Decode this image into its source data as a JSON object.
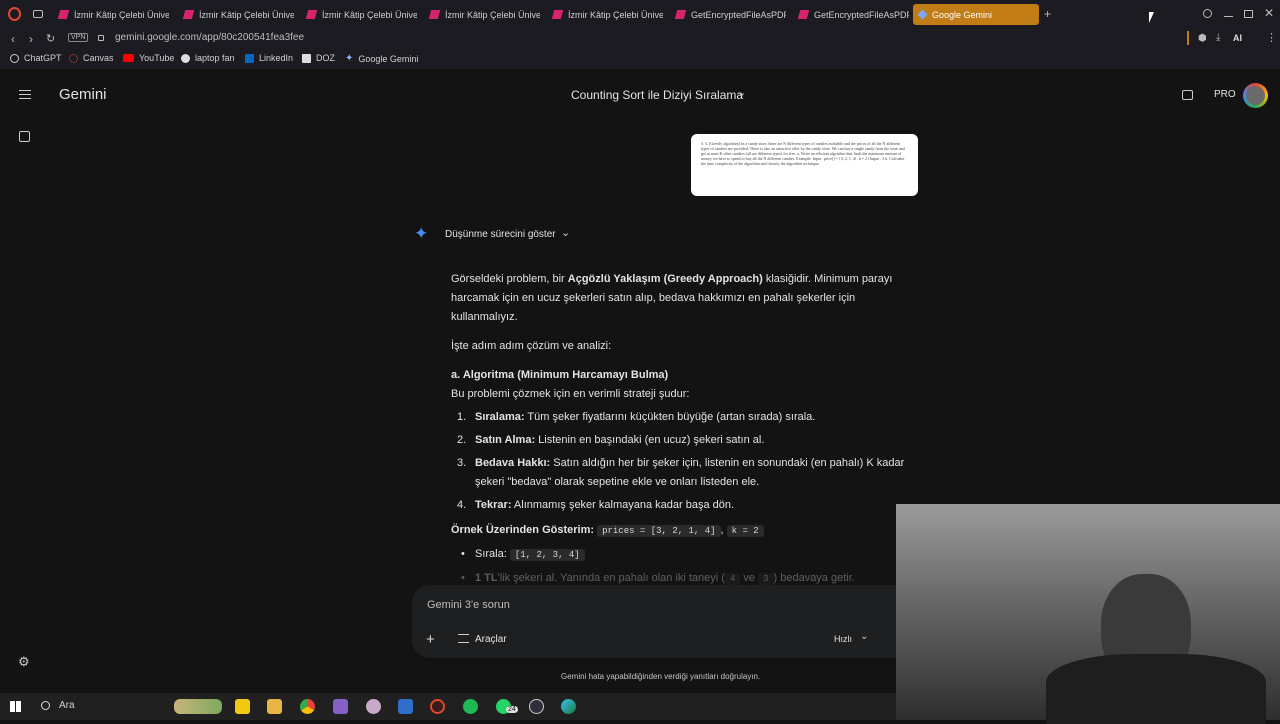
{
  "browser": {
    "tabs": [
      {
        "label": "İzmir Kâtip Çelebi Üniver",
        "active": false
      },
      {
        "label": "İzmir Kâtip Çelebi Üniver",
        "active": false
      },
      {
        "label": "İzmir Kâtip Çelebi Üniver",
        "active": false
      },
      {
        "label": "İzmir Kâtip Çelebi Üniver",
        "active": false
      },
      {
        "label": "İzmir Kâtip Çelebi Üniver",
        "active": false
      },
      {
        "label": "GetEncryptedFileAsPDF",
        "active": false
      },
      {
        "label": "GetEncryptedFileAsPDF",
        "active": false
      },
      {
        "label": "Google Gemini",
        "active": true
      }
    ],
    "url": "gemini.google.com/app/80c200541fea3fee",
    "vpn_label": "VPN",
    "ai_label": "AI",
    "bookmarks": [
      "ChatGPT",
      "Canvas",
      "YouTube",
      "laptop fan",
      "LinkedIn",
      "DOZ",
      "Google Gemini"
    ]
  },
  "gemini": {
    "app_name": "Gemini",
    "conversation_title": "Counting Sort ile Diziyi Sıralama",
    "pro_label": "PRO",
    "attached_image_text": "3. 3. (Greedy algorithm) In a candy store, there are N different types of candies available and the prices of all the N different types of candies are provided. There is also an attractive offer by the candy store. We can buy a single candy from the store and get at most K other candies (all are different types) for free. a. Write an efficient algorithm that finds the minimum amount of money we have to spend to buy all the N different candies. Example: Input : price[] = {3, 2, 1, 4}, k = 2 Output : 3 b. Calculate the time complexity of the algorithm and classify the algorithm technique.",
    "thinking_label": "Düşünme sürecini göster",
    "response": {
      "intro_1": "Görseldeki problem, bir ",
      "intro_bold": "Açgözlü Yaklaşım (Greedy Approach)",
      "intro_2": " klasiğidir. Minimum parayı harcamak için en ucuz şekerleri satın alıp, bedava hakkımızı en pahalı şekerler için kullanmalıyız.",
      "step_intro": "İşte adım adım çözüm ve analizi:",
      "heading_a": "a. Algoritma (Minimum Harcamayı Bulma)",
      "strategy": "Bu problemi çözmek için en verimli strateji şudur:",
      "steps": [
        {
          "num": "1.",
          "bold": "Sıralama:",
          "text": " Tüm şeker fiyatlarını küçükten büyüğe (artan sırada) sırala."
        },
        {
          "num": "2.",
          "bold": "Satın Alma:",
          "text": " Listenin en başındaki (en ucuz) şekeri satın al."
        },
        {
          "num": "3.",
          "bold": "Bedava Hakkı:",
          "text": " Satın aldığın her bir şeker için, listenin en sonundaki (en pahalı) K kadar şekeri \"bedava\" olarak sepetine ekle ve onları listeden ele."
        },
        {
          "num": "4.",
          "bold": "Tekrar:",
          "text": " Alınmamış şeker kalmayana kadar başa dön."
        }
      ],
      "example_label": "Örnek Üzerinden Gösterim:",
      "example_code_1": "prices = [3, 2, 1, 4]",
      "example_code_2": "k = 2",
      "sorted_label": "Sırala:",
      "sorted_code": "[1, 2, 3, 4]",
      "fade_bold": "1 TL",
      "fade_text_1": "'lik şekeri al. Yanında en pahalı olan iki taneyi (",
      "fade_code_1": "4",
      "fade_text_2": " ve ",
      "fade_code_2": "3",
      "fade_text_3": ") bedavaya getir."
    },
    "input_placeholder": "Gemini 3'e sorun",
    "tools_label": "Araçlar",
    "mode_label": "Hızlı",
    "disclaimer": "Gemini hata yapabildiğinden verdiği yanıtları doğrulayın."
  },
  "taskbar": {
    "search_label": "Ara",
    "badge": "24"
  }
}
